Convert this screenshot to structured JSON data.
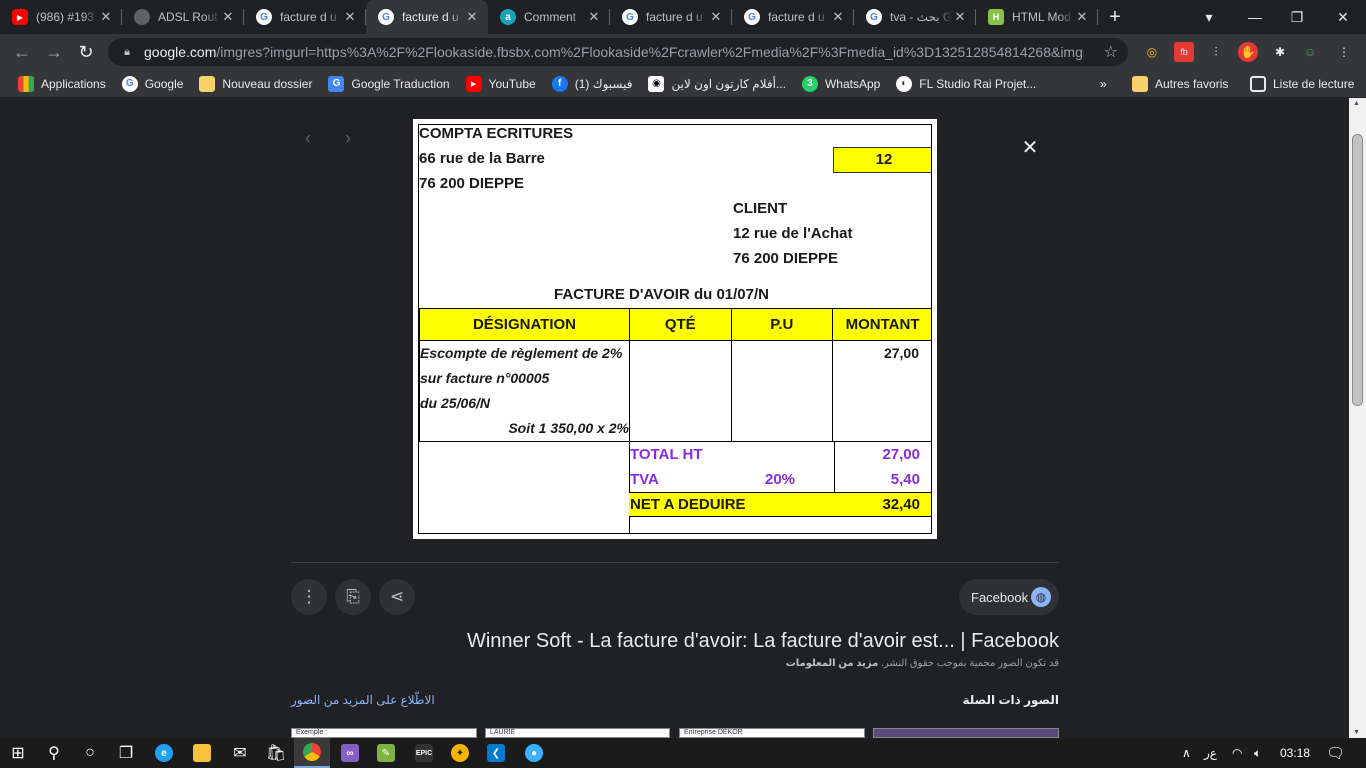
{
  "tabs": [
    {
      "title": "(986) #193",
      "favicon": "youtube-icon",
      "active": false
    },
    {
      "title": "ADSL Rout",
      "favicon": "globe-icon",
      "active": false
    },
    {
      "title": "facture d u",
      "favicon": "google-icon",
      "active": false
    },
    {
      "title": "facture d u",
      "favicon": "google-icon",
      "active": true
    },
    {
      "title": "Comment",
      "favicon": "comment-icon",
      "active": false
    },
    {
      "title": "facture d u",
      "favicon": "google-icon",
      "active": false
    },
    {
      "title": "facture d u",
      "favicon": "google-icon",
      "active": false
    },
    {
      "title": "tva - بحث G",
      "favicon": "google-icon",
      "active": false
    },
    {
      "title": "HTML Mod",
      "favicon": "html-icon",
      "active": false
    }
  ],
  "address_bar": {
    "host": "google.com",
    "path": "/imgres?imgurl=https%3A%2F%2Flookaside.fbsbx.com%2Flookaside%2Fcrawler%2Fmedia%2F%3Fmedia_id%3D132512854814268&imgref..."
  },
  "bookmarks": [
    {
      "label": "Applications",
      "icon": "apps-icon"
    },
    {
      "label": "Google",
      "icon": "google-icon"
    },
    {
      "label": "Nouveau dossier",
      "icon": "folder-icon"
    },
    {
      "label": "Google Traduction",
      "icon": "translate-icon"
    },
    {
      "label": "YouTube",
      "icon": "youtube-icon"
    },
    {
      "label": "(1) فيسبوك",
      "icon": "facebook-icon"
    },
    {
      "label": "أفلام كارتون اون لاين...",
      "icon": "tv-icon"
    },
    {
      "label": "WhatsApp",
      "icon": "whatsapp-icon"
    },
    {
      "label": "FL Studio Rai Projet...",
      "icon": "fl-icon"
    }
  ],
  "bookmarks_overflow": "»",
  "bookmarks_right": [
    {
      "label": "Autres favoris",
      "icon": "folder-icon"
    },
    {
      "label": "Liste de lecture",
      "icon": "reading-list-icon"
    }
  ],
  "invoice": {
    "company_name": "COMPTA ECRITURES",
    "company_address_1": "66 rue de la Barre",
    "company_address_2": "76 200 DIEPPE",
    "invoice_number": "12",
    "client_name": "CLIENT",
    "client_address_1": "12 rue de l'Achat",
    "client_address_2": "76 200 DIEPPE",
    "document_title": "FACTURE D'AVOIR du  01/07/N",
    "headers": {
      "designation": "DÉSIGNATION",
      "qty": "QTÉ",
      "unit_price": "P.U",
      "amount": "MONTANT"
    },
    "description_lines": [
      "Escompte de règlement de 2%",
      "sur facture n°00005",
      "du 25/06/N",
      "Soit 1 350,00 x 2%"
    ],
    "line_amount": "27,00",
    "total_ht_label": "TOTAL HT",
    "total_ht_value": "27,00",
    "tva_label": "TVA",
    "tva_rate": "20%",
    "tva_value": "5,40",
    "net_label": "NET A DEDUIRE",
    "net_value": "32,40"
  },
  "source": {
    "label": "Facebook"
  },
  "result_title": "Winner Soft - La facture d'avoir: La facture d'avoir est... | Facebook",
  "copyright_text": "قد تكون الصور محمية بموجب حقوق النشر.",
  "copyright_link": "مزيد من المعلومات",
  "related_images_label": "الصور ذات الصلة",
  "see_more_label": "الاطّلاع على المزيد من الصور",
  "thumbnails": [
    {
      "text": "Exemple :"
    },
    {
      "text": "LAURIE"
    },
    {
      "text": "Entreprise DEKOR"
    },
    {
      "text": ""
    }
  ],
  "taskbar": {
    "time": "03:18",
    "ime": "ﻉﺭ"
  },
  "colors": {
    "invoice_yellow": "#ffff00",
    "totals_purple": "#8a2be2",
    "link_blue": "#8ab4f8"
  }
}
